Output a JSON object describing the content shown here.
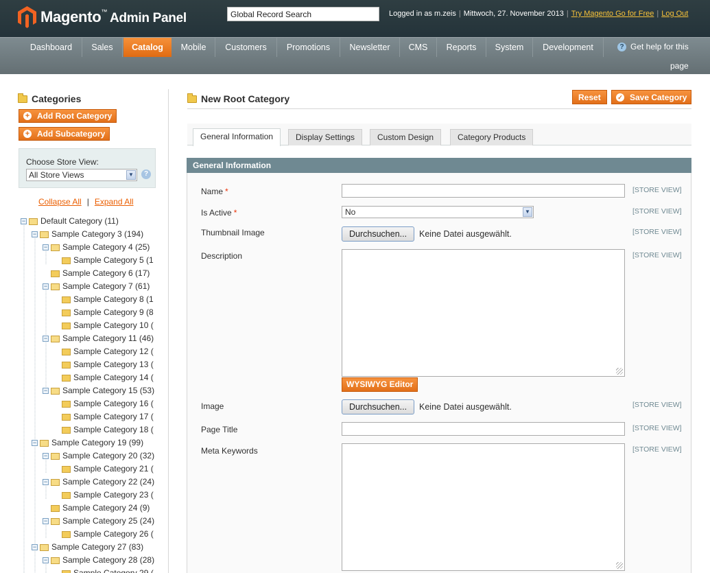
{
  "header": {
    "brand": "Magento",
    "brand_suffix": "Admin Panel",
    "search_value": "Global Record Search",
    "logged_in": "Logged in as m.zeis",
    "date": "Mittwoch, 27. November 2013",
    "try_link": "Try Magento Go for Free",
    "logout_link": "Log Out"
  },
  "nav": {
    "items": [
      "Dashboard",
      "Sales",
      "Catalog",
      "Mobile",
      "Customers",
      "Promotions",
      "Newsletter",
      "CMS",
      "Reports",
      "System",
      "Development"
    ],
    "active": "Catalog",
    "help": "Get help for this",
    "help_page": "page"
  },
  "left": {
    "title": "Categories",
    "add_root": "Add Root Category",
    "add_sub": "Add Subcategory",
    "store_label": "Choose Store View:",
    "store_value": "All Store Views",
    "collapse_all": "Collapse All",
    "expand_all": "Expand All",
    "tree": [
      {
        "label": "Default Category (11)",
        "level": 0,
        "toggle": true
      },
      {
        "label": "Sample Category 3 (194)",
        "level": 1,
        "toggle": true
      },
      {
        "label": "Sample Category 4 (25)",
        "level": 2,
        "toggle": true
      },
      {
        "label": "Sample Category 5 (1",
        "level": 3,
        "toggle": false
      },
      {
        "label": "Sample Category 6 (17)",
        "level": 2,
        "toggle": false
      },
      {
        "label": "Sample Category 7 (61)",
        "level": 2,
        "toggle": true
      },
      {
        "label": "Sample Category 8 (1",
        "level": 3,
        "toggle": false
      },
      {
        "label": "Sample Category 9 (8",
        "level": 3,
        "toggle": false
      },
      {
        "label": "Sample Category 10 (",
        "level": 3,
        "toggle": false
      },
      {
        "label": "Sample Category 11 (46)",
        "level": 2,
        "toggle": true
      },
      {
        "label": "Sample Category 12 (",
        "level": 3,
        "toggle": false
      },
      {
        "label": "Sample Category 13 (",
        "level": 3,
        "toggle": false
      },
      {
        "label": "Sample Category 14 (",
        "level": 3,
        "toggle": false
      },
      {
        "label": "Sample Category 15 (53)",
        "level": 2,
        "toggle": true
      },
      {
        "label": "Sample Category 16 (",
        "level": 3,
        "toggle": false
      },
      {
        "label": "Sample Category 17 (",
        "level": 3,
        "toggle": false
      },
      {
        "label": "Sample Category 18 (",
        "level": 3,
        "toggle": false
      },
      {
        "label": "Sample Category 19 (99)",
        "level": 1,
        "toggle": true
      },
      {
        "label": "Sample Category 20 (32)",
        "level": 2,
        "toggle": true
      },
      {
        "label": "Sample Category 21 (",
        "level": 3,
        "toggle": false
      },
      {
        "label": "Sample Category 22 (24)",
        "level": 2,
        "toggle": true
      },
      {
        "label": "Sample Category 23 (",
        "level": 3,
        "toggle": false
      },
      {
        "label": "Sample Category 24 (9)",
        "level": 2,
        "toggle": false
      },
      {
        "label": "Sample Category 25 (24)",
        "level": 2,
        "toggle": true
      },
      {
        "label": "Sample Category 26 (",
        "level": 3,
        "toggle": false
      },
      {
        "label": "Sample Category 27 (83)",
        "level": 1,
        "toggle": true
      },
      {
        "label": "Sample Category 28 (28)",
        "level": 2,
        "toggle": true
      },
      {
        "label": "Sample Category 29 (",
        "level": 3,
        "toggle": false
      }
    ]
  },
  "main": {
    "title": "New Root Category",
    "reset": "Reset",
    "save": "Save Category",
    "tabs": [
      "General Information",
      "Display Settings",
      "Custom Design",
      "Category Products"
    ],
    "section": "General Information",
    "fields": {
      "name": "Name",
      "is_active": "Is Active",
      "is_active_value": "No",
      "thumbnail": "Thumbnail Image",
      "description": "Description",
      "image": "Image",
      "page_title": "Page Title",
      "meta_keywords": "Meta Keywords"
    },
    "required_mark": "*",
    "browse": "Durchsuchen...",
    "no_file": "Keine Datei ausgewählt.",
    "wysiwyg": "WYSIWYG Editor",
    "scope": "[STORE VIEW]"
  },
  "colors": {
    "accent": "#e2701a",
    "header_bg": "#2f3e42",
    "nav_bg": "#6f7b80",
    "section_head": "#6f8992"
  }
}
